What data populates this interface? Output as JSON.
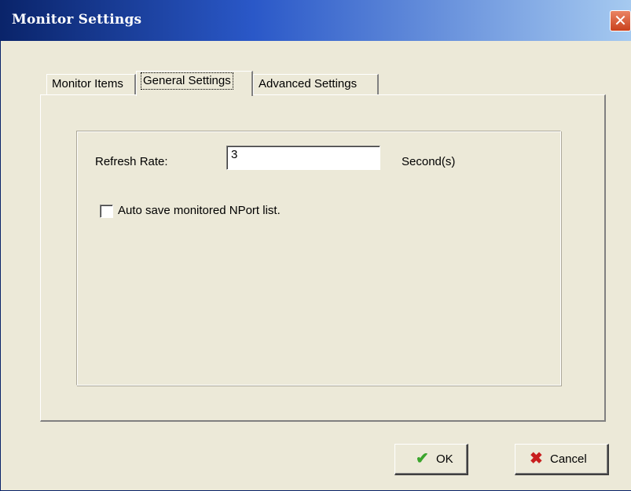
{
  "window": {
    "title": "Monitor Settings",
    "close_glyph": "✕"
  },
  "tabs": [
    {
      "label": "Monitor Items",
      "active": false
    },
    {
      "label": "General Settings",
      "active": true
    },
    {
      "label": "Advanced Settings",
      "active": false
    }
  ],
  "general": {
    "refresh_rate_label": "Refresh Rate:",
    "refresh_rate_value": "3",
    "refresh_rate_unit": "Second(s)",
    "auto_save_label": "Auto save monitored NPort list.",
    "auto_save_checked": false
  },
  "buttons": {
    "ok_label": "OK",
    "ok_icon": "check-icon",
    "cancel_label": "Cancel",
    "cancel_icon": "x-icon"
  },
  "colors": {
    "ok_check": "#3aa52c",
    "cancel_x": "#c81e1e",
    "titlebar_start": "#0a246a",
    "titlebar_end": "#a6caf0"
  }
}
